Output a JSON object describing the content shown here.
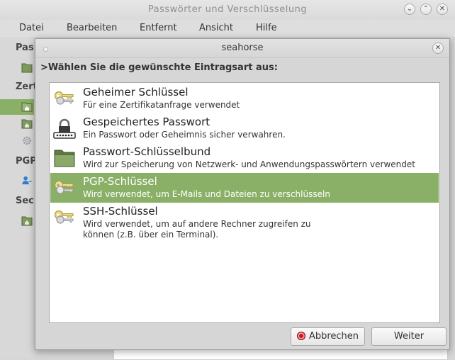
{
  "main_window": {
    "title": "Passwörter und Verschlüsselung",
    "menu": [
      "Datei",
      "Bearbeiten",
      "Entfernt",
      "Ansicht",
      "Hilfe"
    ],
    "sidebar_headings": [
      "Pas",
      "Zerti",
      "PGP",
      "Sec"
    ]
  },
  "dialog": {
    "title": "seahorse",
    "prompt": ">Wählen Sie die gewünschte Eintragsart aus:",
    "items": [
      {
        "title": "Geheimer Schlüssel",
        "description": "Für eine Zertifikatanfrage verwendet",
        "icon": "keys-icon"
      },
      {
        "title": "Gespeichertes Passwort",
        "description": "Ein Passwort oder Geheimnis sicher verwahren.",
        "icon": "padlock-password-icon"
      },
      {
        "title": "Passwort-Schlüsselbund",
        "description": "Wird zur Speicherung von Netzwerk- und Anwendungspasswörtern verwendet",
        "icon": "folder-icon"
      },
      {
        "title": "PGP-Schlüssel",
        "description": "Wird verwendet, um E-Mails und Dateien zu verschlüsseln",
        "icon": "keys-icon",
        "selected": true
      },
      {
        "title": "SSH-Schlüssel",
        "description": "Wird verwendet, um auf andere Rechner zugreifen zu können (z.B. über ein Terminal).",
        "icon": "keys-icon"
      }
    ],
    "buttons": {
      "cancel": "Abbrechen",
      "next": "Weiter"
    }
  },
  "colors": {
    "selection": "#8ab067",
    "cancel_icon": "#d91414"
  }
}
